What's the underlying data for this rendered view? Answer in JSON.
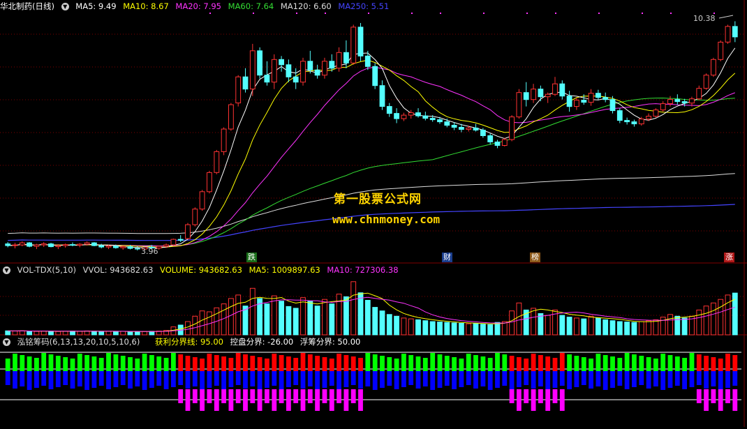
{
  "main": {
    "title": "华北制药(日线)",
    "ma": [
      {
        "label": "MA5: 9.49",
        "color": "#ffffff"
      },
      {
        "label": "MA10: 8.67",
        "color": "#ffff00"
      },
      {
        "label": "MA20: 7.95",
        "color": "#ff33ff"
      },
      {
        "label": "MA60: 7.64",
        "color": "#33dd33"
      },
      {
        "label": "MA120: 6.60",
        "color": "#dddddd"
      },
      {
        "label": "MA250: 5.51",
        "color": "#4444ff"
      }
    ],
    "high_label": "10.38",
    "low_label": "3.96",
    "badges": [
      {
        "text": "跌",
        "bg": "#1a6e1a",
        "color": "#ffffff"
      },
      {
        "text": "财",
        "bg": "#1a3e8e",
        "color": "#ffffff"
      },
      {
        "text": "榜",
        "bg": "#8e5a1a",
        "color": "#ffffff"
      },
      {
        "text": "涨",
        "bg": "#b01818",
        "color": "#ffffff"
      }
    ]
  },
  "watermark": {
    "line1": "第一股票公式网",
    "line2": "www.chnmoney.com"
  },
  "volume": {
    "title": "VOL-TDX(5,10)",
    "items": [
      {
        "label": "VVOL: 943682.63",
        "color": "#dddddd"
      },
      {
        "label": "VOLUME: 943682.63",
        "color": "#ffff00"
      },
      {
        "label": "MA5: 1009897.63",
        "color": "#ffff00"
      },
      {
        "label": "MA10: 727306.38",
        "color": "#ff33ff"
      }
    ]
  },
  "chips": {
    "title": "泓铭筹码(6,13,13,20,10,5,10,6)",
    "items": [
      {
        "label": "获利分界线: 95.00",
        "color": "#ffff00"
      },
      {
        "label": "控盘分界: -26.00",
        "color": "#ffffff"
      },
      {
        "label": "浮筹分界: 50.00",
        "color": "#ffffff"
      }
    ]
  },
  "colors": {
    "up": "#ff3232",
    "down": "#54ffff",
    "grid": "#800000",
    "ma5": "#ffffff",
    "ma10": "#ffff00",
    "ma20": "#ff33ff",
    "ma60": "#33dd33",
    "ma120": "#dddddd",
    "ma250": "#4444ff",
    "chip_green": "#00ff00",
    "chip_red": "#ff0000",
    "chip_blue": "#0000ff",
    "chip_magenta": "#ff00ff"
  },
  "chart_data": {
    "type": "candlestick",
    "period": "daily",
    "candles": [
      [
        4.15,
        4.2,
        4.05,
        4.1
      ],
      [
        4.1,
        4.18,
        4.02,
        4.12
      ],
      [
        4.12,
        4.22,
        4.08,
        4.18
      ],
      [
        4.18,
        4.2,
        4.05,
        4.08
      ],
      [
        4.08,
        4.15,
        4.0,
        4.12
      ],
      [
        4.12,
        4.2,
        4.06,
        4.15
      ],
      [
        4.15,
        4.18,
        4.05,
        4.07
      ],
      [
        4.07,
        4.14,
        4.0,
        4.1
      ],
      [
        4.1,
        4.16,
        4.04,
        4.13
      ],
      [
        4.13,
        4.19,
        4.08,
        4.11
      ],
      [
        4.11,
        4.17,
        4.05,
        4.14
      ],
      [
        4.14,
        4.22,
        4.1,
        4.18
      ],
      [
        4.18,
        4.2,
        4.08,
        4.1
      ],
      [
        4.1,
        4.15,
        4.02,
        4.06
      ],
      [
        4.06,
        4.12,
        4.0,
        4.09
      ],
      [
        4.09,
        4.13,
        4.01,
        4.04
      ],
      [
        4.04,
        4.1,
        3.98,
        4.07
      ],
      [
        4.07,
        4.12,
        3.99,
        4.02
      ],
      [
        4.02,
        4.08,
        3.96,
        4.0
      ],
      [
        4.0,
        4.08,
        3.96,
        4.05
      ],
      [
        4.05,
        4.12,
        4.0,
        4.03
      ],
      [
        4.03,
        4.1,
        3.98,
        4.08
      ],
      [
        4.08,
        4.16,
        4.03,
        4.12
      ],
      [
        4.12,
        4.3,
        4.1,
        4.28
      ],
      [
        4.28,
        4.4,
        4.2,
        4.25
      ],
      [
        4.3,
        4.75,
        4.28,
        4.7
      ],
      [
        4.7,
        5.2,
        4.65,
        5.15
      ],
      [
        5.15,
        5.7,
        5.1,
        5.65
      ],
      [
        5.65,
        6.25,
        5.6,
        6.2
      ],
      [
        6.2,
        6.85,
        6.15,
        6.8
      ],
      [
        6.8,
        7.5,
        6.7,
        7.45
      ],
      [
        7.45,
        8.2,
        7.4,
        8.15
      ],
      [
        8.2,
        9.0,
        8.1,
        8.95
      ],
      [
        8.95,
        9.2,
        8.5,
        8.6
      ],
      [
        8.6,
        9.9,
        8.4,
        9.7
      ],
      [
        9.7,
        9.8,
        8.9,
        9.0
      ],
      [
        9.0,
        9.4,
        8.7,
        8.8
      ],
      [
        8.8,
        9.6,
        8.6,
        9.45
      ],
      [
        9.45,
        9.55,
        9.1,
        9.3
      ],
      [
        9.3,
        9.45,
        8.8,
        8.95
      ],
      [
        8.95,
        9.2,
        8.6,
        8.8
      ],
      [
        8.8,
        9.5,
        8.7,
        9.4
      ],
      [
        9.4,
        9.7,
        9.05,
        9.15
      ],
      [
        9.15,
        9.3,
        8.9,
        9.0
      ],
      [
        9.0,
        9.5,
        8.9,
        9.4
      ],
      [
        9.4,
        9.6,
        9.1,
        9.2
      ],
      [
        9.2,
        9.8,
        9.1,
        9.65
      ],
      [
        9.65,
        10.0,
        9.2,
        9.35
      ],
      [
        9.35,
        10.45,
        9.3,
        10.38
      ],
      [
        10.38,
        10.5,
        9.4,
        9.55
      ],
      [
        9.55,
        9.7,
        9.15,
        9.25
      ],
      [
        9.25,
        9.35,
        8.6,
        8.7
      ],
      [
        8.7,
        8.85,
        8.0,
        8.1
      ],
      [
        8.1,
        8.2,
        7.8,
        7.9
      ],
      [
        7.9,
        8.05,
        7.62,
        7.75
      ],
      [
        7.75,
        7.92,
        7.68,
        7.85
      ],
      [
        7.85,
        8.0,
        7.75,
        7.92
      ],
      [
        7.92,
        8.05,
        7.78,
        7.83
      ],
      [
        7.83,
        7.95,
        7.7,
        7.76
      ],
      [
        7.76,
        7.85,
        7.66,
        7.72
      ],
      [
        7.72,
        7.8,
        7.6,
        7.66
      ],
      [
        7.66,
        7.75,
        7.5,
        7.56
      ],
      [
        7.56,
        7.65,
        7.42,
        7.5
      ],
      [
        7.5,
        7.6,
        7.36,
        7.44
      ],
      [
        7.44,
        7.55,
        7.38,
        7.48
      ],
      [
        7.48,
        7.6,
        7.38,
        7.42
      ],
      [
        7.42,
        7.48,
        7.2,
        7.26
      ],
      [
        7.26,
        7.32,
        7.0,
        7.08
      ],
      [
        7.08,
        7.14,
        6.9,
        6.98
      ],
      [
        6.98,
        7.2,
        6.95,
        7.15
      ],
      [
        7.15,
        7.85,
        7.1,
        7.8
      ],
      [
        7.8,
        8.6,
        7.75,
        8.5
      ],
      [
        8.5,
        8.8,
        8.1,
        8.3
      ],
      [
        8.3,
        8.75,
        8.2,
        8.6
      ],
      [
        8.6,
        8.7,
        8.25,
        8.38
      ],
      [
        8.38,
        8.5,
        8.2,
        8.45
      ],
      [
        8.45,
        8.95,
        8.4,
        8.75
      ],
      [
        8.75,
        8.85,
        8.3,
        8.4
      ],
      [
        8.4,
        8.55,
        7.95,
        8.1
      ],
      [
        8.1,
        8.35,
        8.0,
        8.28
      ],
      [
        8.28,
        8.45,
        8.15,
        8.22
      ],
      [
        8.22,
        8.6,
        8.12,
        8.48
      ],
      [
        8.48,
        8.58,
        8.3,
        8.36
      ],
      [
        8.36,
        8.5,
        8.22,
        8.3
      ],
      [
        8.3,
        8.4,
        7.9,
        7.98
      ],
      [
        7.98,
        8.05,
        7.62,
        7.7
      ],
      [
        7.7,
        7.78,
        7.58,
        7.66
      ],
      [
        7.66,
        7.72,
        7.52,
        7.6
      ],
      [
        7.6,
        7.8,
        7.55,
        7.74
      ],
      [
        7.74,
        7.9,
        7.68,
        7.82
      ],
      [
        7.82,
        8.05,
        7.78,
        8.0
      ],
      [
        8.0,
        8.25,
        7.95,
        8.18
      ],
      [
        8.18,
        8.4,
        8.1,
        8.3
      ],
      [
        8.3,
        8.45,
        8.15,
        8.24
      ],
      [
        8.24,
        8.32,
        8.1,
        8.2
      ],
      [
        8.2,
        8.38,
        8.1,
        8.32
      ],
      [
        8.32,
        8.7,
        8.28,
        8.62
      ],
      [
        8.62,
        9.05,
        8.58,
        9.0
      ],
      [
        9.0,
        9.5,
        8.95,
        9.45
      ],
      [
        9.45,
        10.0,
        9.4,
        9.95
      ],
      [
        9.95,
        10.45,
        9.9,
        10.4
      ],
      [
        10.4,
        10.55,
        9.95,
        10.1
      ]
    ],
    "volume": [
      90,
      85,
      92,
      80,
      78,
      86,
      82,
      75,
      80,
      84,
      79,
      88,
      82,
      76,
      80,
      74,
      78,
      72,
      70,
      75,
      80,
      85,
      100,
      180,
      220,
      300,
      420,
      540,
      520,
      610,
      700,
      820,
      900,
      650,
      1050,
      820,
      700,
      880,
      760,
      640,
      600,
      840,
      760,
      650,
      800,
      700,
      920,
      860,
      1200,
      950,
      780,
      620,
      540,
      460,
      420,
      380,
      360,
      340,
      320,
      300,
      290,
      280,
      270,
      260,
      250,
      260,
      240,
      230,
      280,
      300,
      540,
      720,
      560,
      600,
      480,
      440,
      560,
      440,
      400,
      380,
      360,
      420,
      380,
      340,
      320,
      300,
      290,
      280,
      300,
      320,
      340,
      400,
      460,
      420,
      380,
      420,
      560,
      650,
      720,
      800,
      900,
      944
    ],
    "ylim": [
      3.7,
      10.8
    ]
  }
}
